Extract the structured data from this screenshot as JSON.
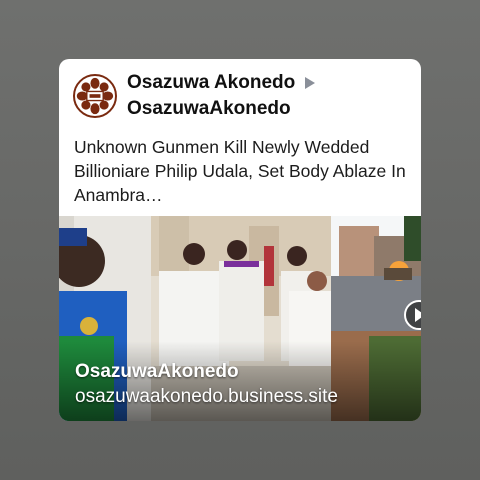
{
  "post": {
    "author_name": "Osazuwa Akonedo",
    "page_name": "OsazuwaAkonedo",
    "text": "Unknown Gunmen Kill Newly Wedded Billioniare Philip Udala, Set Body Ablaze In Anambra…"
  },
  "link_preview": {
    "title": "OsazuwaAkonedo",
    "domain": "osazuwaakonedo.business.site"
  },
  "icons": {
    "avatar": "logo-avatar-icon",
    "arrow": "share-arrow-icon",
    "play": "play-icon"
  },
  "colors": {
    "background": "#666765",
    "card": "#ffffff",
    "logo": "#7a2a10",
    "arrow": "#8a8f99"
  }
}
